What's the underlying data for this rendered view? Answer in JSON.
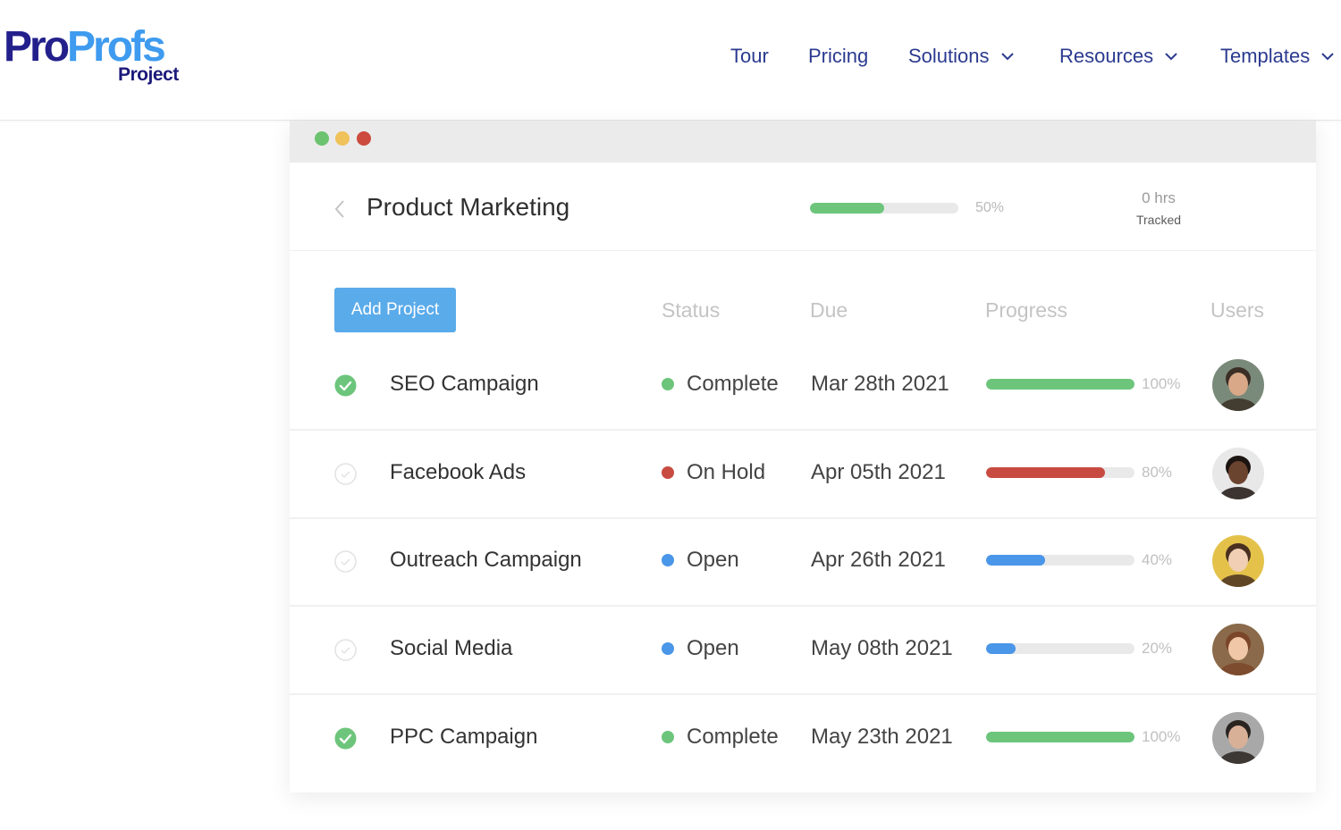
{
  "header": {
    "logo": {
      "main_pro": "Pro",
      "main_profs": "Profs",
      "sub": "Project"
    },
    "nav": [
      {
        "label": "Tour",
        "dropdown": false
      },
      {
        "label": "Pricing",
        "dropdown": false
      },
      {
        "label": "Solutions",
        "dropdown": true
      },
      {
        "label": "Resources",
        "dropdown": true
      },
      {
        "label": "Templates",
        "dropdown": true
      }
    ]
  },
  "window_dots": {
    "colors": [
      "#6cc36f",
      "#f0c25b",
      "#cc4a3e"
    ]
  },
  "project": {
    "title": "Product Marketing",
    "progress_label": "50%",
    "progress": 0.5,
    "hours_value": "0 hrs",
    "hours_label": "Tracked"
  },
  "toolbar": {
    "add_label": "Add Project"
  },
  "columns": {
    "status": "Status",
    "due": "Due",
    "progress": "Progress",
    "users": "Users"
  },
  "colors": {
    "complete": "#6cc57b",
    "on_hold": "#c84b42",
    "open": "#4a96e8",
    "button": "#5aabea"
  },
  "tasks": [
    {
      "name": "SEO Campaign",
      "done": true,
      "status": "Complete",
      "status_color": "#6cc57b",
      "due": "Mar 28th 2021",
      "progress": 1.0,
      "progress_label": "100%",
      "bar_color": "#6cc57b",
      "avatar": "man-with-beard-avatar"
    },
    {
      "name": "Facebook Ads",
      "done": false,
      "status": "On Hold",
      "status_color": "#c84b42",
      "due": "Apr 05th 2021",
      "progress": 0.8,
      "progress_label": "80%",
      "bar_color": "#c84b42",
      "avatar": "woman-with-glasses-avatar"
    },
    {
      "name": "Outreach Campaign",
      "done": false,
      "status": "Open",
      "status_color": "#4a96e8",
      "due": "Apr 26th 2021",
      "progress": 0.4,
      "progress_label": "40%",
      "bar_color": "#4a96e8",
      "avatar": "woman-yellow-background-avatar"
    },
    {
      "name": "Social Media",
      "done": false,
      "status": "Open",
      "status_color": "#4a96e8",
      "due": "May 08th 2021",
      "progress": 0.2,
      "progress_label": "20%",
      "bar_color": "#4a96e8",
      "avatar": "woman-curly-hair-avatar"
    },
    {
      "name": "PPC Campaign",
      "done": true,
      "status": "Complete",
      "status_color": "#6cc57b",
      "due": "May 23th 2021",
      "progress": 1.0,
      "progress_label": "100%",
      "bar_color": "#6cc57b",
      "avatar": "man-with-glasses-avatar"
    }
  ]
}
